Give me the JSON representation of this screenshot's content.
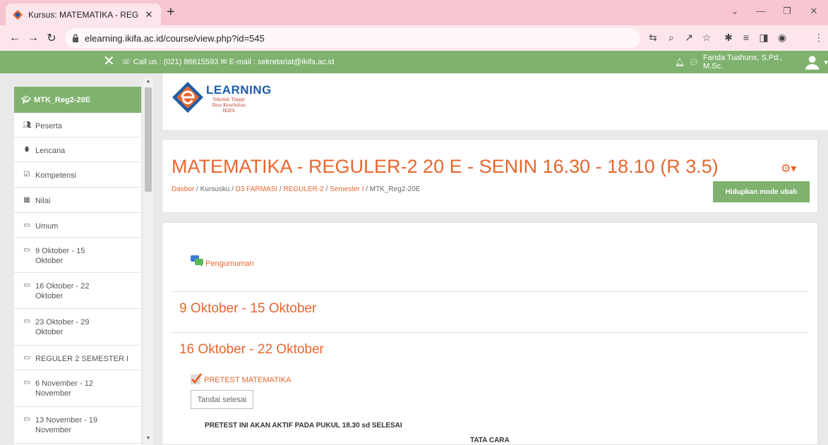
{
  "browser": {
    "tab_title": "Kursus: MATEMATIKA - REGULER",
    "url": "elearning.ikifa.ac.id/course/view.php?id=545"
  },
  "sitebar": {
    "contact": "☏ Call us : (021) 86615593 ✉ E-mail : sekretariat@ikifa.ac.id",
    "user_name": "Farida Tuahuns, S.Pd., M.Sc."
  },
  "logo": {
    "title": "LEARNING",
    "subtitle": "Sekolah Tinggi Ilmu Kesehatan IKIFA"
  },
  "sidebar": {
    "course": "MTK_Reg2-20E",
    "items": [
      {
        "icon": "users-icon",
        "label": "Peserta"
      },
      {
        "icon": "badge-icon",
        "label": "Lencana"
      },
      {
        "icon": "checkbox-icon",
        "label": "Kompetensi"
      },
      {
        "icon": "table-icon",
        "label": "Nilai"
      },
      {
        "icon": "folder-icon",
        "label": "Umum"
      },
      {
        "icon": "folder-icon",
        "label": "9 Oktober - 15 Oktober"
      },
      {
        "icon": "folder-icon",
        "label": "16 Oktober - 22 Oktober"
      },
      {
        "icon": "folder-icon",
        "label": "23 Oktober - 29 Oktober"
      },
      {
        "icon": "folder-icon",
        "label": "REGULER 2 SEMESTER I"
      },
      {
        "icon": "folder-icon",
        "label": "6 November - 12 November"
      },
      {
        "icon": "folder-icon",
        "label": "13 November - 19 November"
      }
    ]
  },
  "course": {
    "title": "MATEMATIKA - REGULER-2 20 E - SENIN 16.30 - 18.10 (R 3.5)",
    "breadcrumb": [
      "Dasbor",
      "Kursusku",
      "D3 FARMASI",
      "REGULER-2",
      "Semester I",
      "MTK_Reg2-20E"
    ],
    "edit_button": "Hidupkan mode ubah"
  },
  "content": {
    "announcement": "Pengumuman",
    "section1": "9 Oktober - 15 Oktober",
    "section2": "16 Oktober - 22 Oktober",
    "quiz": "PRETEST MATEMATIKA",
    "mark_done": "Tandai selesai",
    "notice": "PRETEST INI AKAN AKTIF PADA PUKUL 18.30 sd SELESAI",
    "tata": "TATA CARA"
  },
  "colors": {
    "accent": "#e8662e",
    "green": "#7fb26e",
    "tabbar": "#f7c6d0"
  }
}
